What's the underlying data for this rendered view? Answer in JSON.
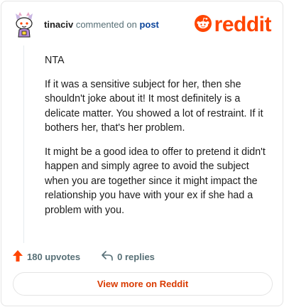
{
  "header": {
    "username": "tinaciv",
    "action": "commented on",
    "post_link": "post",
    "brand": "reddit"
  },
  "comment": {
    "paragraphs": [
      "NTA",
      "If it was a sensitive subject for her, then she shouldn't joke about it! It most definitely is a delicate matter. You showed a lot of restraint. If it bothers her, that's her problem.",
      "It might be a good idea to offer to pretend it didn't happen and simply agree to avoid the subject when you are together since it might impact the relationship you have with your ex if she had a problem with you."
    ]
  },
  "footer": {
    "upvotes": "180 upvotes",
    "replies": "0 replies"
  },
  "cta": {
    "label": "View more on Reddit"
  },
  "colors": {
    "brand": "#ff4500",
    "link": "#0a449b",
    "cta_text": "#d93a00"
  },
  "icons": [
    "avatar",
    "reddit-logo-icon",
    "upvote-arrow-icon",
    "reply-icon"
  ]
}
